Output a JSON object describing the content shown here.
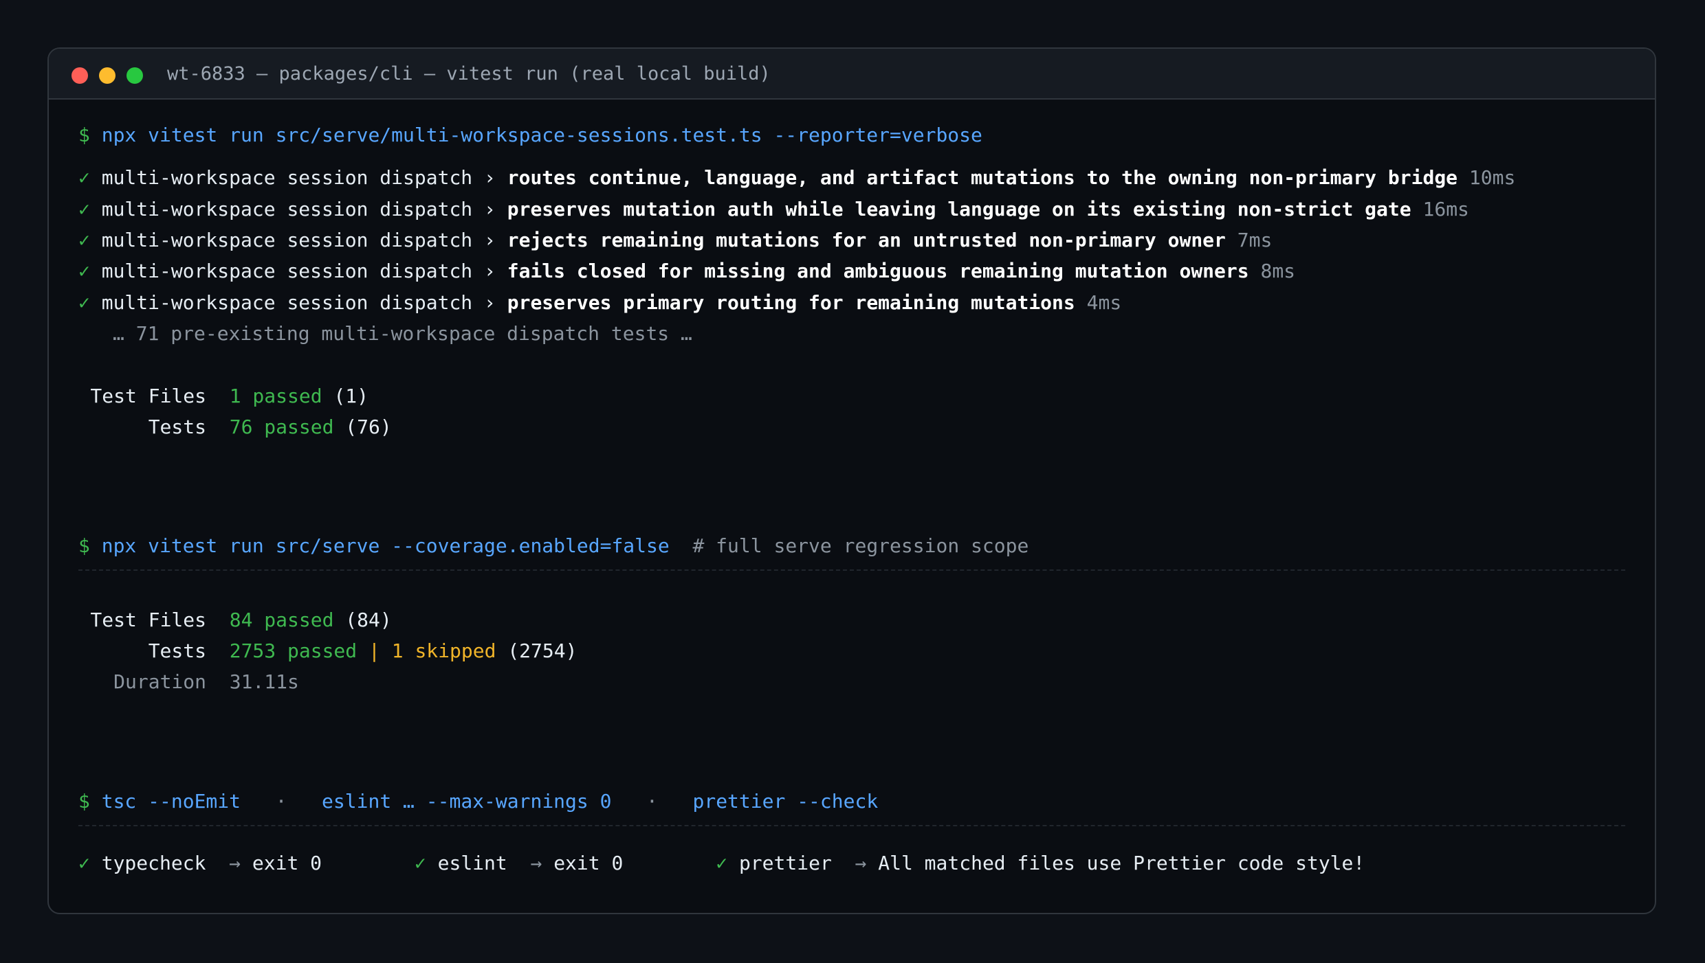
{
  "window": {
    "title": "wt-6833 — packages/cli — vitest run (real local build)"
  },
  "block1": {
    "prompt": "$",
    "command": "npx vitest run src/serve/multi-workspace-sessions.test.ts --reporter=verbose",
    "tests": [
      {
        "check": "✓",
        "suite": "multi-workspace session dispatch",
        "arrow": "›",
        "name": "routes continue, language, and artifact mutations to the owning non-primary bridge",
        "time": "10ms"
      },
      {
        "check": "✓",
        "suite": "multi-workspace session dispatch",
        "arrow": "›",
        "name": "preserves mutation auth while leaving language on its existing non-strict gate",
        "time": "16ms"
      },
      {
        "check": "✓",
        "suite": "multi-workspace session dispatch",
        "arrow": "›",
        "name": "rejects remaining mutations for an untrusted non-primary owner",
        "time": "7ms"
      },
      {
        "check": "✓",
        "suite": "multi-workspace session dispatch",
        "arrow": "›",
        "name": "fails closed for missing and ambiguous remaining mutation owners",
        "time": "8ms"
      },
      {
        "check": "✓",
        "suite": "multi-workspace session dispatch",
        "arrow": "›",
        "name": "preserves primary routing for remaining mutations",
        "time": "4ms"
      }
    ],
    "ellipsis_note": "… 71 pre-existing multi-workspace dispatch tests …",
    "summary": {
      "files_label": "Test Files",
      "files_passed": "1 passed",
      "files_total": "(1)",
      "tests_label": "Tests",
      "tests_passed": "76 passed",
      "tests_total": "(76)"
    }
  },
  "block2": {
    "prompt": "$",
    "command": "npx vitest run src/serve --coverage.enabled=false",
    "comment": "# full serve regression scope",
    "summary": {
      "files_label": "Test Files",
      "files_passed": "84 passed",
      "files_total": "(84)",
      "tests_label": "Tests",
      "tests_passed": "2753 passed",
      "tests_sep": "|",
      "tests_skipped": "1 skipped",
      "tests_total": "(2754)",
      "duration_label": "Duration",
      "duration_value": "31.11s"
    }
  },
  "block3": {
    "prompt": "$",
    "cmd1": "tsc --noEmit",
    "dot": "·",
    "cmd2": "eslint … --max-warnings 0",
    "cmd3": "prettier --check",
    "results": [
      {
        "check": "✓",
        "name": "typecheck",
        "arrow": "→",
        "result": "exit 0"
      },
      {
        "check": "✓",
        "name": "eslint",
        "arrow": "→",
        "result": "exit 0"
      },
      {
        "check": "✓",
        "name": "prettier",
        "arrow": "→",
        "result": "All matched files use Prettier code style!"
      }
    ]
  },
  "colors": {
    "background": "#0d1117",
    "terminal": "#0a0d12",
    "prompt": "#3fb950",
    "command": "#58a6ff",
    "passed": "#3fb950",
    "skipped": "#f0b429",
    "dim": "#8b949e"
  }
}
